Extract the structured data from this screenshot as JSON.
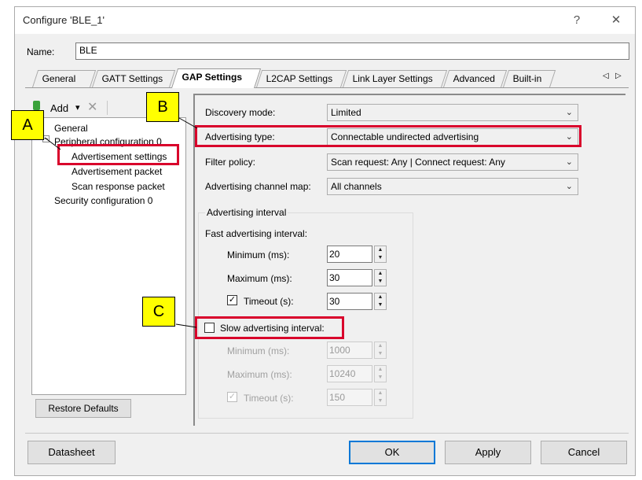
{
  "window": {
    "title": "Configure 'BLE_1'",
    "help_label": "?",
    "close_label": "✕"
  },
  "name_field": {
    "label": "Name:",
    "value": "BLE"
  },
  "tabs": [
    {
      "label": "General"
    },
    {
      "label": "GATT Settings"
    },
    {
      "label": "GAP Settings",
      "active": true
    },
    {
      "label": "L2CAP Settings"
    },
    {
      "label": "Link Layer Settings"
    },
    {
      "label": "Advanced"
    },
    {
      "label": "Built-in"
    }
  ],
  "tab_scroll": {
    "left": "◁",
    "right": "▷"
  },
  "tree_toolbar": {
    "add_label": "Add",
    "add_dropdown": "▾",
    "remove_label": "✕"
  },
  "tree": {
    "general": "General",
    "peripheral": "Peripheral configuration 0",
    "adv_settings": "Advertisement settings",
    "adv_packet": "Advertisement packet",
    "scan_response": "Scan response packet",
    "security": "Security configuration 0",
    "expander": "−"
  },
  "restore_defaults": "Restore Defaults",
  "form": {
    "discovery_mode": {
      "label": "Discovery mode:",
      "value": "Limited"
    },
    "advertising_type": {
      "label": "Advertising type:",
      "value": "Connectable undirected advertising"
    },
    "filter_policy": {
      "label": "Filter policy:",
      "value": "Scan request: Any | Connect request: Any"
    },
    "channel_map": {
      "label": "Advertising channel map:",
      "value": "All channels"
    },
    "chevron": "⌄",
    "interval_group": "Advertising interval",
    "fast": {
      "label": "Fast advertising interval:",
      "minimum_label": "Minimum (ms):",
      "minimum": "20",
      "maximum_label": "Maximum (ms):",
      "maximum": "30",
      "timeout_label": "Timeout (s):",
      "timeout": "30",
      "timeout_checked": true
    },
    "slow": {
      "label": "Slow advertising interval:",
      "checked": false,
      "minimum_label": "Minimum (ms):",
      "minimum": "1000",
      "maximum_label": "Maximum (ms):",
      "maximum": "10240",
      "timeout_label": "Timeout (s):",
      "timeout": "150",
      "timeout_checked": true
    },
    "spin_up": "▲",
    "spin_down": "▼",
    "check_mark": "✓"
  },
  "callouts": {
    "a": "A",
    "b": "B",
    "c": "C"
  },
  "buttons": {
    "datasheet": "Datasheet",
    "ok": "OK",
    "apply": "Apply",
    "cancel": "Cancel"
  },
  "colors": {
    "highlight": "#d9002b",
    "callout": "#ffff00",
    "focus": "#0078d7"
  }
}
